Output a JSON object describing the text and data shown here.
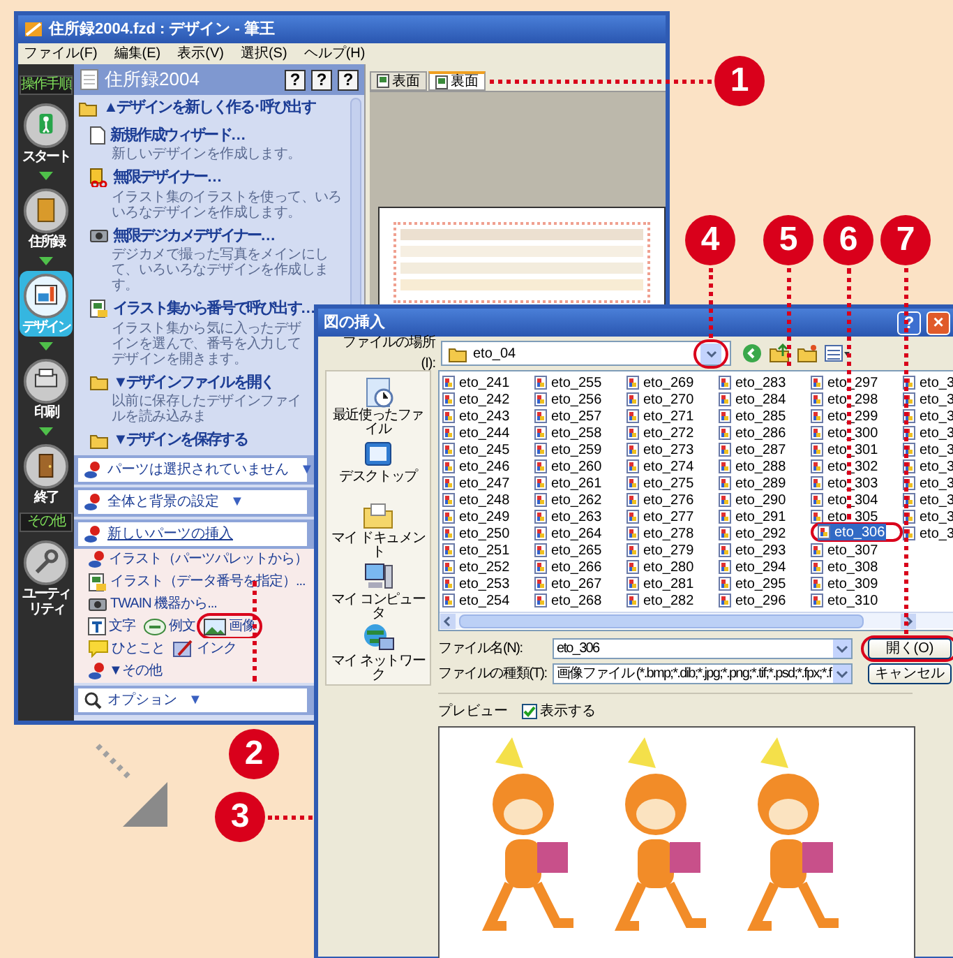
{
  "main_window": {
    "title": "住所録2004.fzd : デザイン - 筆王",
    "menu": [
      "ファイル(F)",
      "編集(E)",
      "表示(V)",
      "選択(S)",
      "ヘルプ(H)"
    ],
    "sidebar": [
      {
        "heading": "操作手順",
        "buttons": [
          {
            "label": "スタート",
            "selected": false
          },
          {
            "label": "住所録",
            "selected": false
          },
          {
            "label": "デザイン",
            "selected": true
          },
          {
            "label": "印刷",
            "selected": false
          },
          {
            "label": "終了",
            "selected": false
          }
        ]
      },
      {
        "heading": "その他",
        "buttons": [
          {
            "label": "ユーティリティ",
            "selected": false
          }
        ]
      }
    ],
    "panel": {
      "title": "住所録2004",
      "help_buttons": [
        "?",
        "?",
        "?"
      ],
      "blocks": [
        {
          "kind": "group_heading",
          "label": "▲デザインを新しく作る･呼び出す"
        },
        {
          "kind": "task",
          "title": "新規作成ウィザード…",
          "description": "新しいデザインを作成します。"
        },
        {
          "kind": "task",
          "title": "無限デザイナー…",
          "description": "イラスト集のイラストを使って、いろいろなデザインを作成します。"
        },
        {
          "kind": "task",
          "title": "無限デジカメデザイナー…",
          "description": "デジカメで撮った写真をメインにして、いろいろなデザインを作成します。"
        },
        {
          "kind": "task",
          "title": "イラスト集から番号で呼び出す…",
          "description": "イラスト集から気に入ったデザインを選んで、番号を入力してデザインを開きます。"
        },
        {
          "kind": "task",
          "title": "▼デザインファイルを開く",
          "description": "以前に保存したデザインファイルを読み込みま"
        },
        {
          "kind": "task",
          "title": "▼デザインを保存する"
        },
        {
          "kind": "bar",
          "label": "パーツは選択されていません",
          "arrow": "▼"
        },
        {
          "kind": "bar",
          "label": "全体と背景の設定",
          "arrow": "▼"
        },
        {
          "kind": "open_bar",
          "label": "新しいパーツの挿入"
        },
        {
          "kind": "insert_row",
          "items": [
            {
              "label": "イラスト（パーツパレットから）",
              "highlighted": false
            }
          ]
        },
        {
          "kind": "insert_row",
          "items": [
            {
              "label": "イラスト（データ番号を指定）...",
              "highlighted": false
            }
          ]
        },
        {
          "kind": "insert_row",
          "items": [
            {
              "label": "TWAIN 機器から...",
              "highlighted": false
            }
          ]
        },
        {
          "kind": "insert_row",
          "items": [
            {
              "label": "文字",
              "highlighted": false
            },
            {
              "label": "例文",
              "highlighted": false
            },
            {
              "label": "画像",
              "highlighted": true
            }
          ]
        },
        {
          "kind": "insert_row",
          "items": [
            {
              "label": "ひとこと",
              "highlighted": false
            },
            {
              "label": "インク",
              "highlighted": false
            }
          ]
        },
        {
          "kind": "insert_row",
          "items": [
            {
              "label": "▼その他",
              "highlighted": false
            }
          ]
        },
        {
          "kind": "bar",
          "label": "オプション",
          "arrow": "▼"
        }
      ]
    },
    "tabs": [
      {
        "label": "表面",
        "selected": false
      },
      {
        "label": "裏面",
        "selected": true
      }
    ]
  },
  "dialog": {
    "title": "図の挿入",
    "help_button": "?",
    "close_button": "×",
    "location": {
      "label": "ファイルの場所(I):",
      "value": "eto_04",
      "highlighted": true
    },
    "places": [
      "最近使ったファイル",
      "デスクトップ",
      "マイ ドキュメント",
      "マイ コンピュータ",
      "マイ ネットワーク"
    ],
    "files": [
      {
        "name": "eto_241",
        "selected": false
      },
      {
        "name": "eto_242",
        "selected": false
      },
      {
        "name": "eto_243",
        "selected": false
      },
      {
        "name": "eto_244",
        "selected": false
      },
      {
        "name": "eto_245",
        "selected": false
      },
      {
        "name": "eto_246",
        "selected": false
      },
      {
        "name": "eto_247",
        "selected": false
      },
      {
        "name": "eto_248",
        "selected": false
      },
      {
        "name": "eto_249",
        "selected": false
      },
      {
        "name": "eto_250",
        "selected": false
      },
      {
        "name": "eto_251",
        "selected": false
      },
      {
        "name": "eto_252",
        "selected": false
      },
      {
        "name": "eto_253",
        "selected": false
      },
      {
        "name": "eto_254",
        "selected": false
      },
      {
        "name": "eto_255",
        "selected": false
      },
      {
        "name": "eto_256",
        "selected": false
      },
      {
        "name": "eto_257",
        "selected": false
      },
      {
        "name": "eto_258",
        "selected": false
      },
      {
        "name": "eto_259",
        "selected": false
      },
      {
        "name": "eto_260",
        "selected": false
      },
      {
        "name": "eto_261",
        "selected": false
      },
      {
        "name": "eto_262",
        "selected": false
      },
      {
        "name": "eto_263",
        "selected": false
      },
      {
        "name": "eto_264",
        "selected": false
      },
      {
        "name": "eto_265",
        "selected": false
      },
      {
        "name": "eto_266",
        "selected": false
      },
      {
        "name": "eto_267",
        "selected": false
      },
      {
        "name": "eto_268",
        "selected": false
      },
      {
        "name": "eto_269",
        "selected": false
      },
      {
        "name": "eto_270",
        "selected": false
      },
      {
        "name": "eto_271",
        "selected": false
      },
      {
        "name": "eto_272",
        "selected": false
      },
      {
        "name": "eto_273",
        "selected": false
      },
      {
        "name": "eto_274",
        "selected": false
      },
      {
        "name": "eto_275",
        "selected": false
      },
      {
        "name": "eto_276",
        "selected": false
      },
      {
        "name": "eto_277",
        "selected": false
      },
      {
        "name": "eto_278",
        "selected": false
      },
      {
        "name": "eto_279",
        "selected": false
      },
      {
        "name": "eto_280",
        "selected": false
      },
      {
        "name": "eto_281",
        "selected": false
      },
      {
        "name": "eto_282",
        "selected": false
      },
      {
        "name": "eto_283",
        "selected": false
      },
      {
        "name": "eto_284",
        "selected": false
      },
      {
        "name": "eto_285",
        "selected": false
      },
      {
        "name": "eto_286",
        "selected": false
      },
      {
        "name": "eto_287",
        "selected": false
      },
      {
        "name": "eto_288",
        "selected": false
      },
      {
        "name": "eto_289",
        "selected": false
      },
      {
        "name": "eto_290",
        "selected": false
      },
      {
        "name": "eto_291",
        "selected": false
      },
      {
        "name": "eto_292",
        "selected": false
      },
      {
        "name": "eto_293",
        "selected": false
      },
      {
        "name": "eto_294",
        "selected": false
      },
      {
        "name": "eto_295",
        "selected": false
      },
      {
        "name": "eto_296",
        "selected": false
      },
      {
        "name": "eto_297",
        "selected": false
      },
      {
        "name": "eto_298",
        "selected": false
      },
      {
        "name": "eto_299",
        "selected": false
      },
      {
        "name": "eto_300",
        "selected": false
      },
      {
        "name": "eto_301",
        "selected": false
      },
      {
        "name": "eto_302",
        "selected": false
      },
      {
        "name": "eto_303",
        "selected": false
      },
      {
        "name": "eto_304",
        "selected": false
      },
      {
        "name": "eto_305",
        "selected": false
      },
      {
        "name": "eto_306",
        "selected": true
      },
      {
        "name": "eto_307",
        "selected": false
      },
      {
        "name": "eto_308",
        "selected": false
      },
      {
        "name": "eto_309",
        "selected": false
      },
      {
        "name": "eto_310",
        "selected": false
      },
      {
        "name": "eto_3",
        "selected": false
      },
      {
        "name": "eto_3",
        "selected": false
      },
      {
        "name": "eto_3",
        "selected": false
      },
      {
        "name": "eto_3",
        "selected": false
      },
      {
        "name": "eto_3",
        "selected": false
      },
      {
        "name": "eto_3",
        "selected": false
      },
      {
        "name": "eto_3",
        "selected": false
      },
      {
        "name": "eto_3",
        "selected": false
      },
      {
        "name": "eto_3",
        "selected": false
      },
      {
        "name": "eto_3",
        "selected": false
      }
    ],
    "file_name": {
      "label": "ファイル名(N):",
      "value": "eto_306"
    },
    "file_type": {
      "label": "ファイルの種類(T):",
      "value": "画像ファイル (*.bmp;*.dib;*.jpg;*.png;*.tif;*.psd;*.fpx;*.f"
    },
    "buttons": [
      {
        "label": "開く(O)",
        "highlighted": true
      },
      {
        "label": "キャンセル",
        "highlighted": false
      }
    ],
    "preview": {
      "label": "プレビュー",
      "show": {
        "label": "表示する",
        "checked": true
      }
    }
  },
  "callouts": [
    "1",
    "2",
    "3",
    "4",
    "5",
    "6",
    "7"
  ]
}
